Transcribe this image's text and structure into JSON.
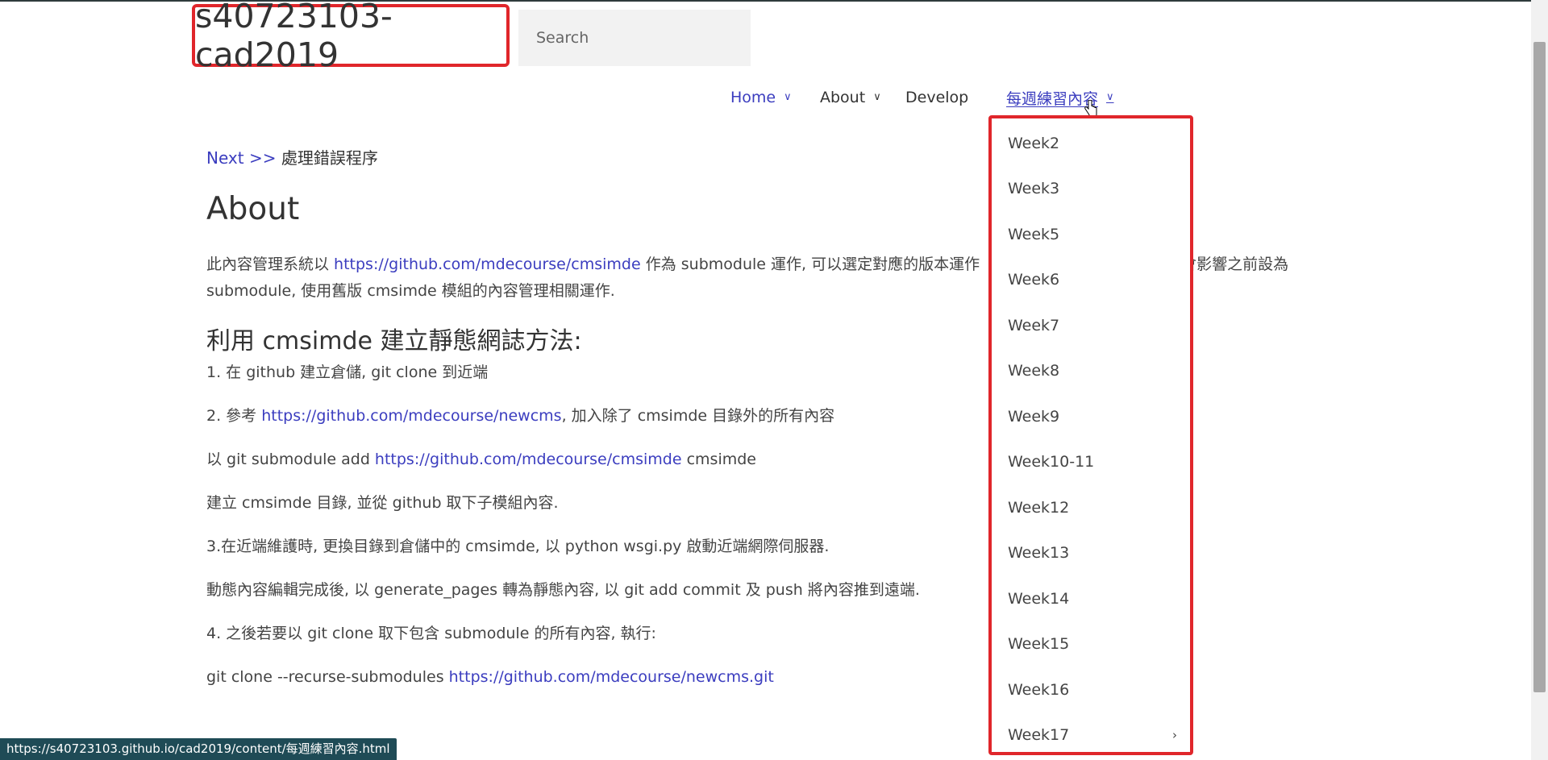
{
  "header": {
    "site_title": "s40723103-cad2019",
    "search_placeholder": "Search"
  },
  "nav": {
    "items": [
      {
        "label": "Home",
        "has_dropdown": true
      },
      {
        "label": "About",
        "has_dropdown": true
      },
      {
        "label": "Develop",
        "has_dropdown": false
      },
      {
        "label": "每週練習內容",
        "has_dropdown": true
      }
    ],
    "dropdown_items": [
      "Week2",
      "Week3",
      "Week5",
      "Week6",
      "Week7",
      "Week8",
      "Week9",
      "Week10-11",
      "Week12",
      "Week13",
      "Week14",
      "Week15",
      "Week16",
      "Week17"
    ]
  },
  "breadcrumb": {
    "link": "Next",
    "separator": ">>",
    "text": "處理錯誤程序"
  },
  "main": {
    "title": "About",
    "p1_a": "此內容管理系統以 ",
    "p1_link": "https://github.com/mdecourse/cmsimde",
    "p1_b": " 作為 submodule 運作, 可以選定對應的版本運作",
    "p1_c": "會影響之前設為",
    "p1_d": "submodule, 使用舊版 cmsimde 模組的內容管理相關運作.",
    "h2": "利用 cmsimde 建立靜態網誌方法:",
    "step1": "1. 在 github 建立倉儲, git clone 到近端",
    "step2_a": "2. 參考 ",
    "step2_link": "https://github.com/mdecourse/newcms",
    "step2_b": ", 加入除了 cmsimde 目錄外的所有內容",
    "step2c_a": "以 git submodule add ",
    "step2c_link": "https://github.com/mdecourse/cmsimde",
    "step2c_b": " cmsimde",
    "step2d": "建立 cmsimde 目錄, 並從 github 取下子模組內容.",
    "step3": "3.在近端維護時, 更換目錄到倉儲中的 cmsimde, 以 python wsgi.py 啟動近端網際伺服器.",
    "step3b": "動態內容編輯完成後, 以 generate_pages 轉為靜態內容, 以 git add commit 及 push 將內容推到遠端.",
    "step4": "4. 之後若要以 git clone 取下包含 submodule 的所有內容, 執行:",
    "step4b_a": "git clone --recurse-submodules ",
    "step4b_link": "https://github.com/mdecourse/newcms.git"
  },
  "statusbar": {
    "url": "https://s40723103.github.io/cad2019/content/每週練習內容.html"
  },
  "colors": {
    "link": "#3b3dbf",
    "highlight_border": "#e0262b",
    "statusbar_bg": "#1f4b56"
  }
}
